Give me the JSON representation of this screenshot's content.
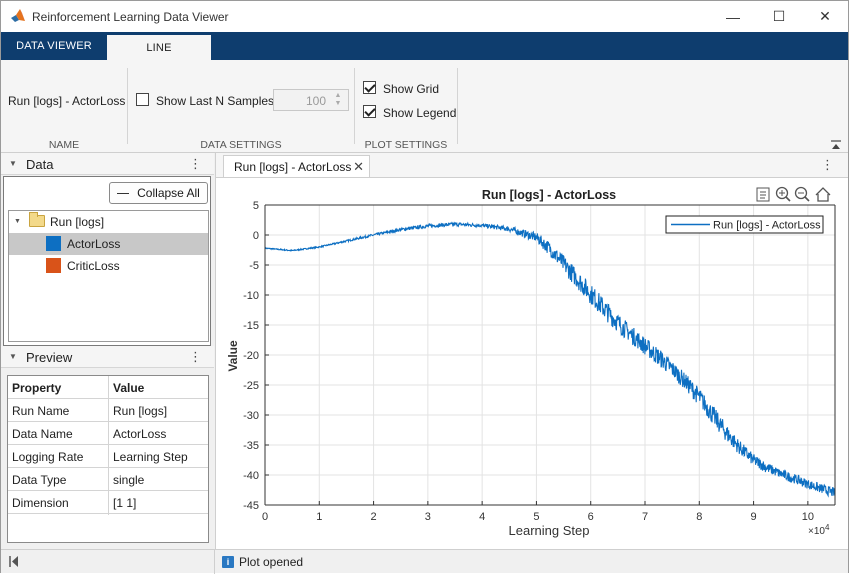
{
  "window": {
    "title": "Reinforcement Learning Data Viewer",
    "minimize_glyph": "—",
    "maximize_glyph": "☐",
    "close_glyph": "✕"
  },
  "ribbon_tabs": [
    {
      "label": "DATA VIEWER",
      "active": false
    },
    {
      "label": "LINE",
      "active": true
    }
  ],
  "ribbon": {
    "name_group": {
      "text": "Run [logs] - ActorLoss",
      "label": "NAME"
    },
    "data_settings": {
      "label": "DATA SETTINGS",
      "show_last_n": {
        "label": "Show Last N Samples",
        "checked": false
      },
      "samples_value": "100"
    },
    "plot_settings": {
      "label": "PLOT SETTINGS",
      "show_grid": {
        "label": "Show Grid",
        "checked": true
      },
      "show_legend": {
        "label": "Show Legend",
        "checked": true
      }
    }
  },
  "data_panel": {
    "title": "Data",
    "collapse_all_label": "Collapse All",
    "tree": {
      "root": "Run [logs]",
      "items": [
        {
          "label": "ActorLoss",
          "color": "#0d6fc2",
          "selected": true
        },
        {
          "label": "CriticLoss",
          "color": "#d95319",
          "selected": false
        }
      ]
    }
  },
  "preview_panel": {
    "title": "Preview",
    "columns": [
      "Property",
      "Value"
    ],
    "rows": [
      [
        "Run Name",
        "Run [logs]"
      ],
      [
        "Data Name",
        "ActorLoss"
      ],
      [
        "Logging Rate",
        "Learning Step"
      ],
      [
        "Data Type",
        "single"
      ],
      [
        "Dimension",
        "[1 1]"
      ]
    ]
  },
  "document": {
    "tab_label": "Run [logs] - ActorLoss"
  },
  "status": {
    "message": "Plot opened"
  },
  "colors": {
    "accent": "#0e3d6e",
    "series": "#0d6fc2"
  },
  "chart_data": {
    "type": "line",
    "title": "Run [logs] - ActorLoss",
    "xlabel": "Learning Step",
    "ylabel": "Value",
    "x_exponent_label": "×10",
    "x_exponent": "4",
    "xlim": [
      0,
      105000
    ],
    "ylim": [
      -45,
      5
    ],
    "x_ticks": [
      0,
      1,
      2,
      3,
      4,
      5,
      6,
      7,
      8,
      9,
      10
    ],
    "y_ticks": [
      5,
      0,
      -5,
      -10,
      -15,
      -20,
      -25,
      -30,
      -35,
      -40,
      -45
    ],
    "grid": true,
    "legend_position": "top-right",
    "series": [
      {
        "name": "Run [logs] - ActorLoss",
        "x": [
          0,
          5000,
          10000,
          15000,
          20000,
          25000,
          30000,
          35000,
          40000,
          45000,
          50000,
          52500,
          55000,
          57500,
          60000,
          62500,
          65000,
          67500,
          70000,
          72500,
          75000,
          77500,
          80000,
          82500,
          85000,
          87500,
          90000,
          92500,
          95000,
          97500,
          100000,
          102500,
          105000
        ],
        "y": [
          -2.2,
          -2.6,
          -2.0,
          -1.0,
          0.0,
          0.9,
          1.5,
          1.8,
          1.6,
          1.0,
          -0.4,
          -2.3,
          -4.8,
          -7.3,
          -9.8,
          -12.3,
          -14.6,
          -16.6,
          -18.5,
          -20.3,
          -22.3,
          -24.5,
          -27.0,
          -30.0,
          -33.0,
          -35.5,
          -37.5,
          -38.8,
          -39.8,
          -40.6,
          -41.5,
          -42.3,
          -43.0
        ],
        "noise": [
          0.1,
          0.1,
          0.1,
          0.15,
          0.2,
          0.25,
          0.3,
          0.3,
          0.3,
          0.45,
          0.8,
          1.2,
          1.5,
          1.6,
          1.7,
          1.7,
          1.6,
          1.5,
          1.5,
          1.5,
          1.4,
          1.4,
          1.5,
          1.6,
          1.5,
          1.2,
          1.0,
          0.9,
          0.8,
          0.8,
          0.8,
          0.8,
          0.8
        ]
      }
    ]
  }
}
